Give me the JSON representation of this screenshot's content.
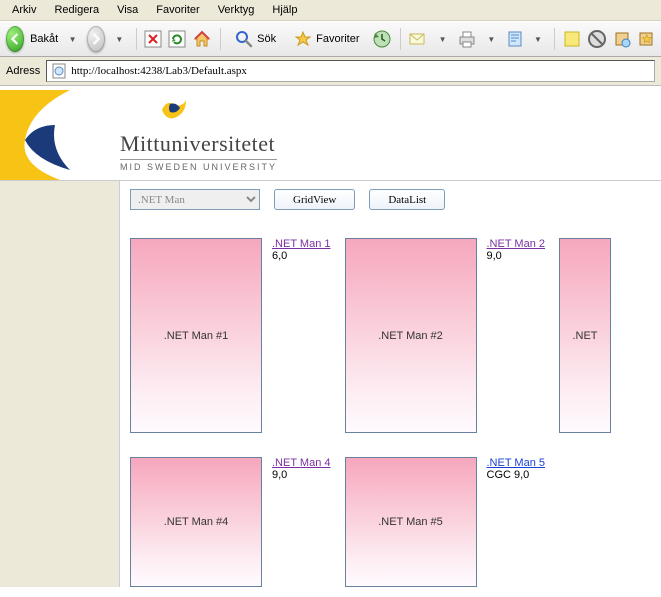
{
  "menu": {
    "items": [
      "Arkiv",
      "Redigera",
      "Visa",
      "Favoriter",
      "Verktyg",
      "Hjälp"
    ]
  },
  "toolbar": {
    "back": "Bakåt",
    "search": "Sök",
    "favorites": "Favoriter"
  },
  "address": {
    "label": "Adress",
    "url": "http://localhost:4238/Lab3/Default.aspx"
  },
  "logo": {
    "name": "Mittuniversitetet",
    "sub": "MID SWEDEN UNIVERSITY"
  },
  "controls": {
    "dropdown_selected": ".NET Man",
    "btn_gridview": "GridView",
    "btn_datalist": "DataList"
  },
  "tiles": [
    {
      "box": ".NET Man #1",
      "link": ".NET Man 1",
      "price": "6,0",
      "visited": true
    },
    {
      "box": ".NET Man #2",
      "link": ".NET Man 2",
      "price": "9,0",
      "visited": true
    },
    {
      "box": ".NET",
      "link": "",
      "price": "",
      "visited": false,
      "cut": true
    },
    {
      "box": ".NET Man #4",
      "link": ".NET Man 4",
      "price": "9,0",
      "visited": true
    },
    {
      "box": ".NET Man #5",
      "link": ".NET Man 5",
      "price": "CGC 9,0",
      "visited": false
    }
  ]
}
